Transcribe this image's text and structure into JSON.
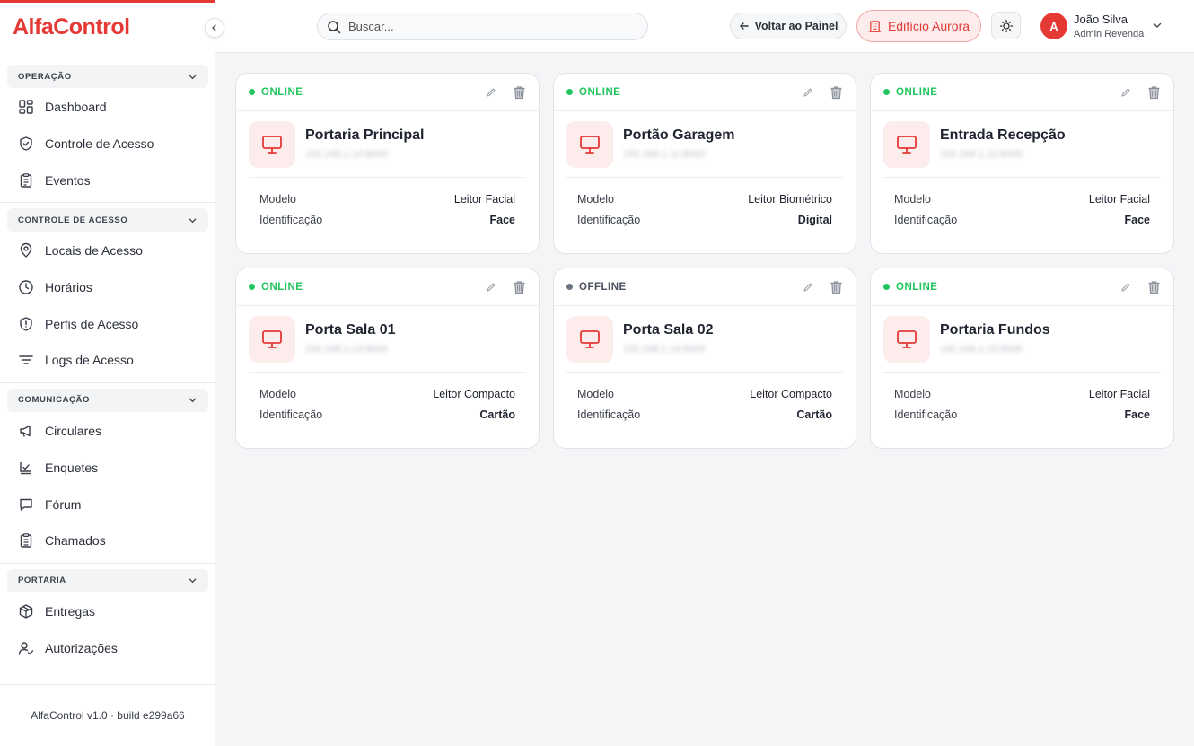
{
  "app": {
    "logo": "AlfaControl",
    "footer": "AlfaControl v1.0 · build e299a66"
  },
  "sidebar": {
    "sections": [
      {
        "title": "OPERAÇÃO",
        "items": [
          {
            "label": "Dashboard",
            "icon": "dashboard-icon"
          },
          {
            "label": "Controle de Acesso",
            "icon": "shield-icon"
          },
          {
            "label": "Eventos",
            "icon": "clipboard-icon"
          }
        ]
      },
      {
        "title": "CONTROLE DE ACESSO",
        "items": [
          {
            "label": "Locais de Acesso",
            "icon": "map-pin-icon"
          },
          {
            "label": "Horários",
            "icon": "clock-icon"
          },
          {
            "label": "Perfis de Acesso",
            "icon": "shield-alert-icon"
          },
          {
            "label": "Logs de Acesso",
            "icon": "filter-lines-icon"
          }
        ]
      },
      {
        "title": "COMUNICAÇÃO",
        "items": [
          {
            "label": "Circulares",
            "icon": "megaphone-icon"
          },
          {
            "label": "Enquetes",
            "icon": "poll-icon"
          },
          {
            "label": "Fórum",
            "icon": "chat-icon"
          },
          {
            "label": "Chamados",
            "icon": "clipboard-list-icon"
          }
        ]
      },
      {
        "title": "PORTARIA",
        "items": [
          {
            "label": "Entregas",
            "icon": "package-icon"
          },
          {
            "label": "Autorizações",
            "icon": "user-check-icon"
          }
        ]
      }
    ]
  },
  "header": {
    "search_placeholder": "Buscar...",
    "back_label": "Voltar ao Painel",
    "building_label": "Edifício Aurora",
    "user": {
      "initial": "A",
      "name": "João Silva",
      "role": "Admin Revenda"
    }
  },
  "colors": {
    "accent": "#e53935",
    "online": "#22c55e",
    "offline": "#6b7280"
  },
  "labels": {
    "model": "Modelo",
    "identification": "Identificação"
  },
  "devices": [
    {
      "status": "ONLINE",
      "online": true,
      "name": "Portaria Principal",
      "ip": "192.168.1.10:8000",
      "model": "Leitor Facial",
      "identification": "Face"
    },
    {
      "status": "ONLINE",
      "online": true,
      "name": "Portão Garagem",
      "ip": "192.168.1.11:8000",
      "model": "Leitor Biométrico",
      "identification": "Digital"
    },
    {
      "status": "ONLINE",
      "online": true,
      "name": "Entrada Recepção",
      "ip": "192.168.1.12:8000",
      "model": "Leitor Facial",
      "identification": "Face"
    },
    {
      "status": "ONLINE",
      "online": true,
      "name": "Porta Sala 01",
      "ip": "192.168.1.13:8000",
      "model": "Leitor Compacto",
      "identification": "Cartão"
    },
    {
      "status": "OFFLINE",
      "online": false,
      "name": "Porta Sala 02",
      "ip": "192.168.1.14:8000",
      "model": "Leitor Compacto",
      "identification": "Cartão"
    },
    {
      "status": "ONLINE",
      "online": true,
      "name": "Portaria Fundos",
      "ip": "192.168.1.15:8000",
      "model": "Leitor Facial",
      "identification": "Face"
    }
  ]
}
